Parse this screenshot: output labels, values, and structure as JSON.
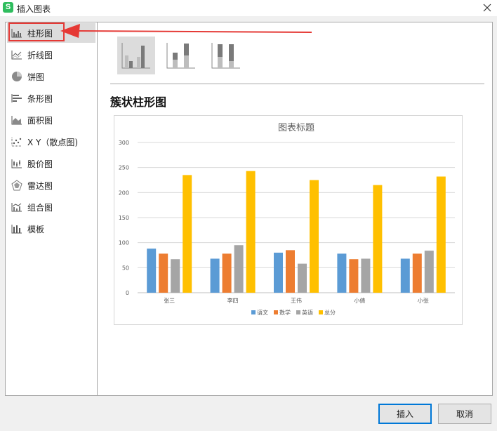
{
  "window": {
    "title": "插入图表",
    "app_icon_letter": "S"
  },
  "sidebar": {
    "items": [
      {
        "label": "柱形图",
        "icon": "column-chart-icon"
      },
      {
        "label": "折线图",
        "icon": "line-chart-icon"
      },
      {
        "label": "饼图",
        "icon": "pie-chart-icon"
      },
      {
        "label": "条形图",
        "icon": "bar-chart-icon"
      },
      {
        "label": "面积图",
        "icon": "area-chart-icon"
      },
      {
        "label": "X Y（散点图)",
        "icon": "scatter-chart-icon"
      },
      {
        "label": "股价图",
        "icon": "stock-chart-icon"
      },
      {
        "label": "雷达图",
        "icon": "radar-chart-icon"
      },
      {
        "label": "组合图",
        "icon": "combo-chart-icon"
      },
      {
        "label": "模板",
        "icon": "template-icon"
      }
    ],
    "selected_index": 0
  },
  "subtypes": {
    "items": [
      {
        "icon": "clustered-column-icon"
      },
      {
        "icon": "stacked-column-icon"
      },
      {
        "icon": "percent-stacked-column-icon"
      }
    ],
    "selected_index": 0,
    "selected_title": "簇状柱形图"
  },
  "buttons": {
    "insert": "插入",
    "cancel": "取消"
  },
  "colors": {
    "accent_border": "#0078d7",
    "annotation": "#e53935",
    "series": [
      "#5b9bd5",
      "#ed7d31",
      "#a5a5a5",
      "#ffc000"
    ]
  },
  "chart_data": {
    "type": "bar",
    "title": "图表标题",
    "categories": [
      "张三",
      "李四",
      "王伟",
      "小倩",
      "小张"
    ],
    "series": [
      {
        "name": "语文",
        "values": [
          88,
          68,
          80,
          78,
          68
        ]
      },
      {
        "name": "数学",
        "values": [
          78,
          78,
          85,
          67,
          78
        ]
      },
      {
        "name": "英语",
        "values": [
          67,
          95,
          58,
          68,
          84
        ]
      },
      {
        "name": "总分",
        "values": [
          235,
          243,
          225,
          215,
          232
        ]
      }
    ],
    "ylim": [
      0,
      300
    ],
    "yticks": [
      0,
      50,
      100,
      150,
      200,
      250,
      300
    ],
    "grid": true,
    "legend": "bottom"
  }
}
